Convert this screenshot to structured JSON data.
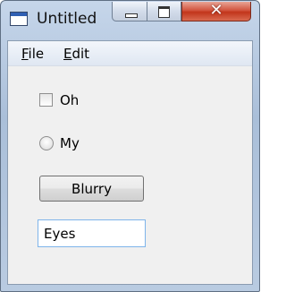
{
  "window": {
    "title": "Untitled",
    "close_glyph": "✕"
  },
  "menubar": {
    "file": {
      "mnemonic": "F",
      "rest": "ile"
    },
    "edit": {
      "mnemonic": "E",
      "rest": "dit"
    }
  },
  "controls": {
    "checkbox": {
      "label": "Oh",
      "checked": false
    },
    "radio": {
      "label": "My",
      "selected": false
    },
    "button": {
      "label": "Blurry"
    },
    "text_field": {
      "value": "Eyes"
    }
  },
  "colors": {
    "title_bar": "#aabfd9",
    "close_button": "#c2351b",
    "client_background": "#f0f0f0",
    "text_field_border": "#7eb4ea"
  },
  "icons": [
    "app-window-icon",
    "minimize-icon",
    "maximize-icon",
    "close-icon"
  ]
}
